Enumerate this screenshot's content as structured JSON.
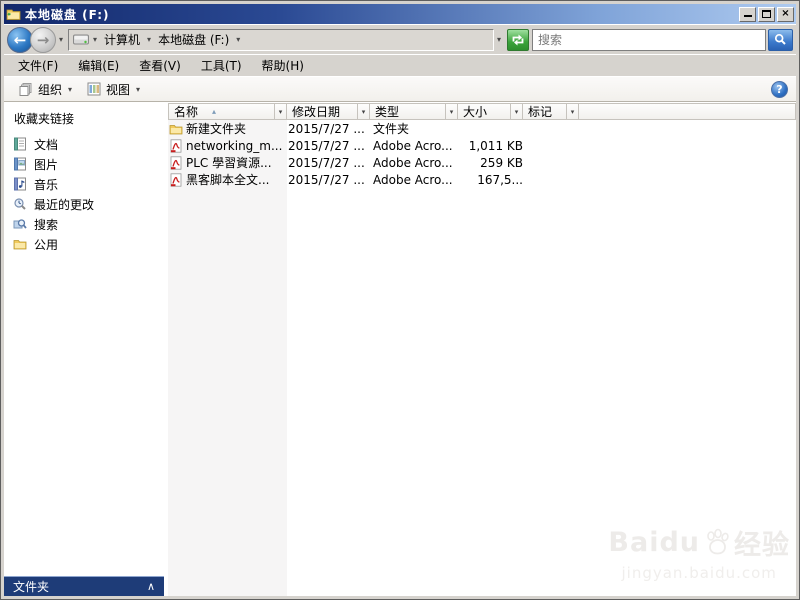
{
  "window": {
    "title": "本地磁盘 (F:)"
  },
  "icons": {
    "chevron_down": "▾",
    "chevron_up": "∧",
    "sort_ascending": "▴",
    "back_arrow": "←",
    "forward_arrow": "→",
    "close": "×",
    "help": "?"
  },
  "addressbar": {
    "breadcrumb": [
      {
        "label": "计算机"
      },
      {
        "label": "本地磁盘 (F:)"
      }
    ],
    "search_placeholder": "搜索"
  },
  "menubar": {
    "items": [
      {
        "label": "文件(F)"
      },
      {
        "label": "编辑(E)"
      },
      {
        "label": "查看(V)"
      },
      {
        "label": "工具(T)"
      },
      {
        "label": "帮助(H)"
      }
    ]
  },
  "toolbar": {
    "organize_label": "组织",
    "views_label": "视图"
  },
  "sidebar": {
    "header": "收藏夹链接",
    "items": [
      {
        "label": "文档"
      },
      {
        "label": "图片"
      },
      {
        "label": "音乐"
      },
      {
        "label": "最近的更改"
      },
      {
        "label": "搜索"
      },
      {
        "label": "公用"
      }
    ],
    "footer": "文件夹"
  },
  "list": {
    "columns": [
      {
        "label": "名称"
      },
      {
        "label": "修改日期"
      },
      {
        "label": "类型"
      },
      {
        "label": "大小"
      },
      {
        "label": "标记"
      }
    ],
    "rows": [
      {
        "icon": "folder",
        "name": "新建文件夹",
        "date": "2015/7/27 ...",
        "type": "文件夹",
        "size": ""
      },
      {
        "icon": "pdf",
        "name": "networking_m...",
        "date": "2015/7/27 ...",
        "type": "Adobe Acro...",
        "size": "1,011 KB"
      },
      {
        "icon": "pdf",
        "name": "PLC 學習資源...",
        "date": "2015/7/27 ...",
        "type": "Adobe Acro...",
        "size": "259 KB"
      },
      {
        "icon": "pdf",
        "name": "黑客脚本全文...",
        "date": "2015/7/27 ...",
        "type": "Adobe Acro...",
        "size": "167,5..."
      }
    ]
  },
  "watermark": {
    "brand": "Baidu",
    "brand_suffix": "经验",
    "url": "jingyan.baidu.com"
  },
  "colors": {
    "titlebar_start": "#12286B",
    "titlebar_end": "#AFCBF0",
    "accent_navy": "#1E3C78",
    "refresh_green": "#3BA33B",
    "search_blue": "#3B79CB",
    "sorted_column": "#F6F5F5"
  }
}
